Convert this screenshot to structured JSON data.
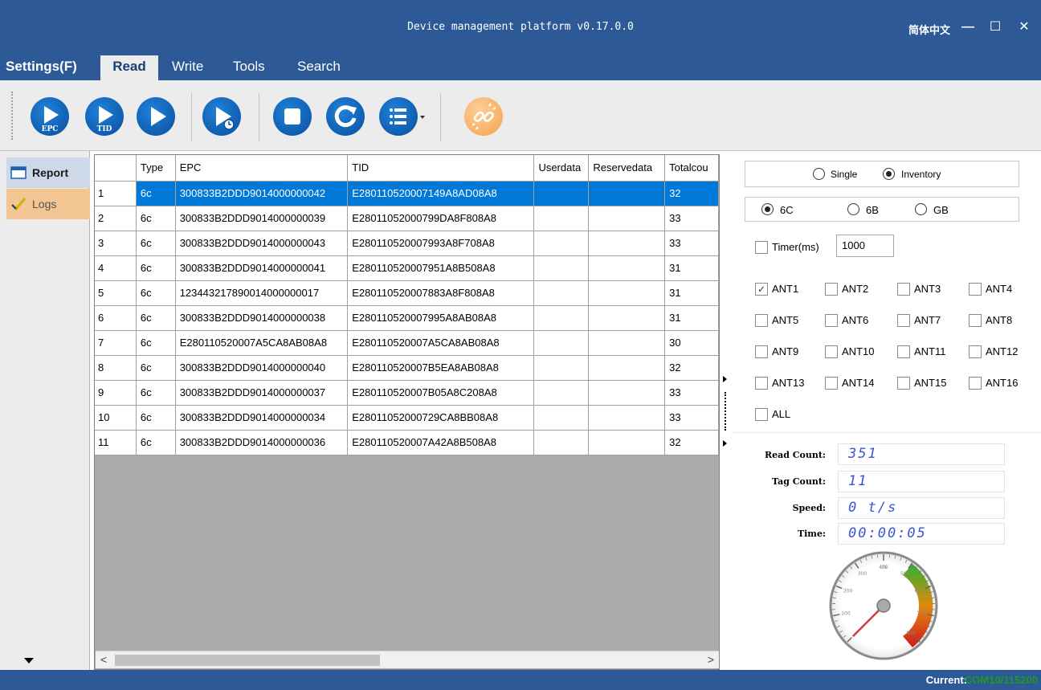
{
  "window": {
    "title": "Device management platform v0.17.0.0",
    "language": "简体中文",
    "minimize": "—",
    "maximize": "☐",
    "close": "✕"
  },
  "menu": {
    "settings": "Settings(F)",
    "read": "Read",
    "write": "Write",
    "tools": "Tools",
    "search": "Search"
  },
  "toolbar": {
    "buttons": [
      {
        "icon": "play-epc-icon",
        "label": "EPC"
      },
      {
        "icon": "play-tid-icon",
        "label": "TID"
      },
      {
        "icon": "play-icon"
      },
      {
        "icon": "play-timer-icon"
      },
      {
        "icon": "stop-icon"
      },
      {
        "icon": "refresh-icon"
      },
      {
        "icon": "list-menu-icon"
      },
      {
        "icon": "unlink-icon"
      }
    ]
  },
  "nav": {
    "report": "Report",
    "logs": "Logs"
  },
  "grid": {
    "columns": [
      "Type",
      "EPC",
      "TID",
      "Userdata",
      "Reservedata",
      "Totalcou"
    ],
    "rows": [
      {
        "n": "1",
        "type": "6c",
        "epc": "300833B2DDD9014000000042",
        "tid": "E280110520007149A8AD08A8",
        "user": "",
        "res": "",
        "total": "32"
      },
      {
        "n": "2",
        "type": "6c",
        "epc": "300833B2DDD9014000000039",
        "tid": "E28011052000799DA8F808A8",
        "user": "",
        "res": "",
        "total": "33"
      },
      {
        "n": "3",
        "type": "6c",
        "epc": "300833B2DDD9014000000043",
        "tid": "E280110520007993A8F708A8",
        "user": "",
        "res": "",
        "total": "33"
      },
      {
        "n": "4",
        "type": "6c",
        "epc": "300833B2DDD9014000000041",
        "tid": "E280110520007951A8B508A8",
        "user": "",
        "res": "",
        "total": "31"
      },
      {
        "n": "5",
        "type": "6c",
        "epc": "123443217890014000000017",
        "tid": "E280110520007883A8F808A8",
        "user": "",
        "res": "",
        "total": "31"
      },
      {
        "n": "6",
        "type": "6c",
        "epc": "300833B2DDD9014000000038",
        "tid": "E280110520007995A8AB08A8",
        "user": "",
        "res": "",
        "total": "31"
      },
      {
        "n": "7",
        "type": "6c",
        "epc": "E280110520007A5CA8AB08A8",
        "tid": "E280110520007A5CA8AB08A8",
        "user": "",
        "res": "",
        "total": "30"
      },
      {
        "n": "8",
        "type": "6c",
        "epc": "300833B2DDD9014000000040",
        "tid": "E280110520007B5EA8AB08A8",
        "user": "",
        "res": "",
        "total": "32"
      },
      {
        "n": "9",
        "type": "6c",
        "epc": "300833B2DDD9014000000037",
        "tid": "E280110520007B05A8C208A8",
        "user": "",
        "res": "",
        "total": "33"
      },
      {
        "n": "10",
        "type": "6c",
        "epc": "300833B2DDD9014000000034",
        "tid": "E28011052000729CA8BB08A8",
        "user": "",
        "res": "",
        "total": "33"
      },
      {
        "n": "11",
        "type": "6c",
        "epc": "300833B2DDD9014000000036",
        "tid": "E280110520007A42A8B508A8",
        "user": "",
        "res": "",
        "total": "32"
      }
    ],
    "selected_row": "1"
  },
  "settings": {
    "mode": {
      "single": "Single",
      "inventory": "Inventory",
      "selected": "Inventory"
    },
    "protocol": {
      "c6": "6C",
      "b6": "6B",
      "gb": "GB",
      "selected": "6C"
    },
    "timer": {
      "label": "Timer(ms)",
      "value": "1000",
      "checked": false
    },
    "antennas": [
      {
        "label": "ANT1",
        "checked": true
      },
      {
        "label": "ANT2",
        "checked": false
      },
      {
        "label": "ANT3",
        "checked": false
      },
      {
        "label": "ANT4",
        "checked": false
      },
      {
        "label": "ANT5",
        "checked": false
      },
      {
        "label": "ANT6",
        "checked": false
      },
      {
        "label": "ANT7",
        "checked": false
      },
      {
        "label": "ANT8",
        "checked": false
      },
      {
        "label": "ANT9",
        "checked": false
      },
      {
        "label": "ANT10",
        "checked": false
      },
      {
        "label": "ANT11",
        "checked": false
      },
      {
        "label": "ANT12",
        "checked": false
      },
      {
        "label": "ANT13",
        "checked": false
      },
      {
        "label": "ANT14",
        "checked": false
      },
      {
        "label": "ANT15",
        "checked": false
      },
      {
        "label": "ANT16",
        "checked": false
      }
    ],
    "all_label": "ALL"
  },
  "stats": {
    "read_count_label": "Read Count:",
    "read_count": "351",
    "tag_count_label": "Tag Count:",
    "tag_count": "11",
    "speed_label": "Speed:",
    "speed": "0 t/s",
    "time_label": "Time:",
    "time": "00:00:05"
  },
  "gauge": {
    "value": 0,
    "min": 0,
    "max": 800,
    "unit": "t/s",
    "tick_labels": [
      "100",
      "200",
      "300",
      "400",
      "500",
      "600",
      "700",
      "800"
    ]
  },
  "status": {
    "current_label": "Current:",
    "port": "COM10/115200"
  },
  "colors": {
    "chrome": "#2d5a96",
    "selection": "#0078d7",
    "accent_blue": "#1a66c4",
    "logs_tab": "#f3c592",
    "lcd_digits": "#3a54d6",
    "port_text": "#1e9a1e"
  }
}
